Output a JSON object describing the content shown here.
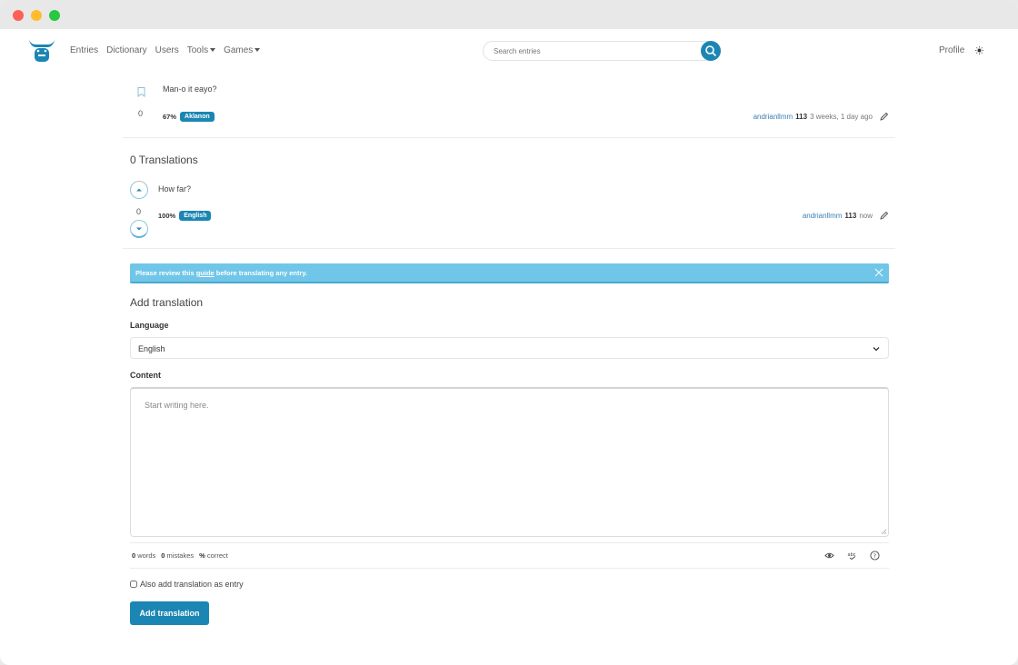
{
  "nav": {
    "links": [
      {
        "label": "Entries"
      },
      {
        "label": "Dictionary"
      },
      {
        "label": "Users"
      },
      {
        "label": "Tools"
      },
      {
        "label": "Games"
      }
    ],
    "search_placeholder": "Search entries",
    "profile_label": "Profile"
  },
  "entry": {
    "text": "Man-o it eayo?",
    "vote_count": "0",
    "score": "67%",
    "language": "Aklanon",
    "author": "andrianllmm",
    "author_score": "113",
    "time": "3 weeks, 1 day ago"
  },
  "translations_heading": "0 Translations",
  "translation": {
    "text": "How far?",
    "vote_count": "0",
    "score": "100%",
    "language": "English",
    "author": "andrianllmm",
    "author_score": "113",
    "time": "now"
  },
  "alert": {
    "before": "Please review this ",
    "link": "guide",
    "after": " before translating any entry."
  },
  "form": {
    "title": "Add translation",
    "language_label": "Language",
    "language_value": "English",
    "content_label": "Content",
    "content_placeholder": "Start writing here.",
    "words_count": "0",
    "words_label": "words",
    "mistakes_count": "0",
    "mistakes_label": "mistakes",
    "correct_value": "%",
    "correct_label": "correct",
    "checkbox_label": "Also add translation as entry",
    "submit_label": "Add translation"
  },
  "colors": {
    "accent": "#1b86b3",
    "alert_bg": "#6fc6e8",
    "user_link": "#3b7fb4"
  }
}
